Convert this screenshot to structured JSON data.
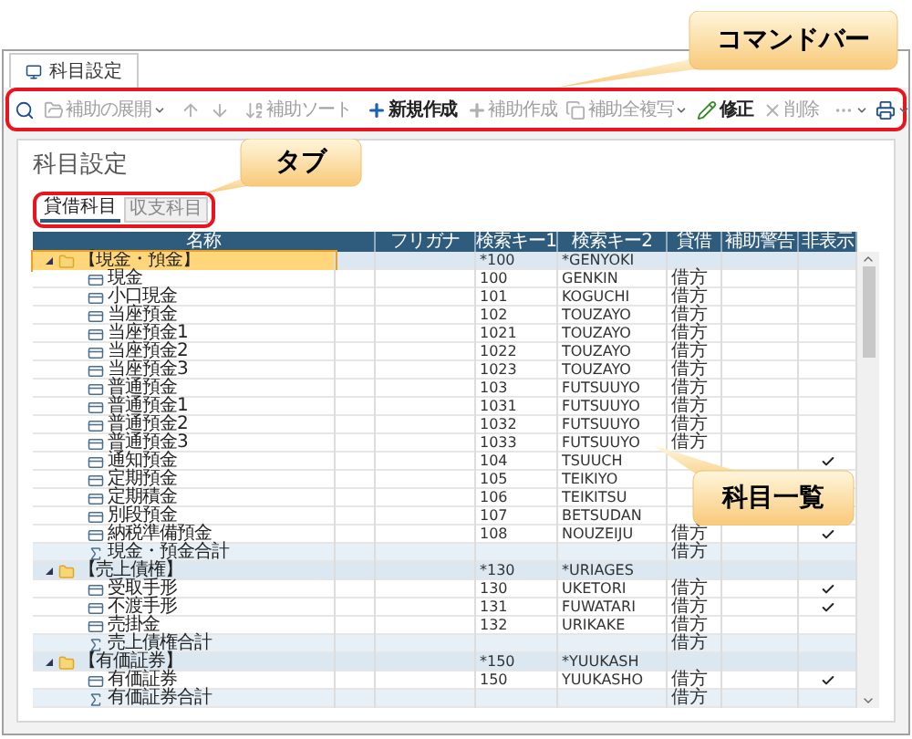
{
  "window": {
    "tab": "科目設定"
  },
  "toolbar": {
    "groups": [
      [
        {
          "disabled": false
        },
        {
          "label": "補助の展開",
          "dropdown": true,
          "disabled": true
        }
      ],
      [
        {
          "disabled": true
        },
        {
          "disabled": true
        }
      ],
      [
        {
          "label": "補助ソート",
          "disabled": true
        }
      ],
      [
        {
          "label": "新規作成",
          "disabled": false
        },
        {
          "label": "補助作成",
          "disabled": true
        },
        {
          "label": "補助全複写",
          "dropdown": true,
          "disabled": true
        },
        {
          "label": "修正",
          "disabled": false
        },
        {
          "label": "削除",
          "disabled": true
        }
      ],
      [
        {
          "dropdown": true,
          "disabled": true
        }
      ]
    ],
    "right": [
      {
        "dropdown": true,
        "disabled": false
      }
    ]
  },
  "page_title": "科目設定",
  "tabs": [
    {
      "label": "貸借科目",
      "selected": true
    },
    {
      "label": "収支科目",
      "selected": false
    }
  ],
  "table": {
    "columns": [
      "名称",
      "フリガナ",
      "検索キー1",
      "検索キー2",
      "貸借",
      "補助警告",
      "非表示"
    ],
    "rows": [
      {
        "kind": "group",
        "name": "【現金・預金】",
        "key1": "*100",
        "key2": "*GENYOKI",
        "expanded": true,
        "selected": true,
        "children": [
          {
            "kind": "account",
            "name": "現金",
            "key1": "100",
            "key2": "GENKIN",
            "drcr": "借方",
            "selected": false,
            "hidden": false
          },
          {
            "kind": "account",
            "name": "小口現金",
            "key1": "101",
            "key2": "KOGUCHI",
            "drcr": "借方",
            "selected": false,
            "hidden": false
          },
          {
            "kind": "account",
            "name": "当座預金",
            "key1": "102",
            "key2": "TOUZAYO",
            "drcr": "借方",
            "selected": false,
            "hidden": false
          },
          {
            "kind": "account",
            "name": "当座預金1",
            "key1": "1021",
            "key2": "TOUZAYO",
            "drcr": "借方",
            "selected": false,
            "hidden": false
          },
          {
            "kind": "account",
            "name": "当座預金2",
            "key1": "1022",
            "key2": "TOUZAYO",
            "drcr": "借方",
            "selected": false,
            "hidden": false
          },
          {
            "kind": "account",
            "name": "当座預金3",
            "key1": "1023",
            "key2": "TOUZAYO",
            "drcr": "借方",
            "selected": false,
            "hidden": false
          },
          {
            "kind": "account",
            "name": "普通預金",
            "key1": "103",
            "key2": "FUTSUUYO",
            "drcr": "借方",
            "selected": false,
            "hidden": false
          },
          {
            "kind": "account",
            "name": "普通預金1",
            "key1": "1031",
            "key2": "FUTSUUYO",
            "drcr": "借方",
            "selected": false,
            "hidden": false
          },
          {
            "kind": "account",
            "name": "普通預金2",
            "key1": "1032",
            "key2": "FUTSUUYO",
            "drcr": "借方",
            "selected": false,
            "hidden": false
          },
          {
            "kind": "account",
            "name": "普通預金3",
            "key1": "1033",
            "key2": "FUTSUUYO",
            "drcr": "借方",
            "selected": false,
            "hidden": false
          },
          {
            "kind": "account",
            "name": "通知預金",
            "key1": "104",
            "key2": "TSUUCH",
            "selected": false,
            "hidden": true
          },
          {
            "kind": "account",
            "name": "定期預金",
            "key1": "105",
            "key2": "TEIKIYO",
            "selected": false,
            "hidden": false
          },
          {
            "kind": "account",
            "name": "定期積金",
            "key1": "106",
            "key2": "TEIKITSU",
            "selected": false,
            "hidden": false
          },
          {
            "kind": "account",
            "name": "別段預金",
            "key1": "107",
            "key2": "BETSUDAN",
            "selected": false,
            "hidden": false
          },
          {
            "kind": "account",
            "name": "納税準備預金",
            "key1": "108",
            "key2": "NOUZEIJU",
            "drcr": "借方",
            "selected": false,
            "hidden": true
          },
          {
            "kind": "total",
            "name": "現金・預金合計",
            "drcr": "借方",
            "selected": false,
            "hidden": false
          }
        ]
      },
      {
        "kind": "group",
        "name": "【売上債権】",
        "key1": "*130",
        "key2": "*URIAGES",
        "expanded": true,
        "selected": false,
        "children": [
          {
            "kind": "account",
            "name": "受取手形",
            "key1": "130",
            "key2": "UKETORI",
            "drcr": "借方",
            "selected": false,
            "hidden": true
          },
          {
            "kind": "account",
            "name": "不渡手形",
            "key1": "131",
            "key2": "FUWATARI",
            "drcr": "借方",
            "selected": false,
            "hidden": true
          },
          {
            "kind": "account",
            "name": "売掛金",
            "key1": "132",
            "key2": "URIKAKE",
            "drcr": "借方",
            "selected": false,
            "hidden": false
          },
          {
            "kind": "total",
            "name": "売上債権合計",
            "drcr": "借方",
            "selected": false,
            "hidden": false
          }
        ]
      },
      {
        "kind": "group",
        "name": "【有価証券】",
        "key1": "*150",
        "key2": "*YUUKASH",
        "expanded": true,
        "selected": false,
        "children": [
          {
            "kind": "account",
            "name": "有価証券",
            "key1": "150",
            "key2": "YUUKASHO",
            "drcr": "借方",
            "selected": false,
            "hidden": true
          },
          {
            "kind": "total",
            "name": "有価証券合計",
            "drcr": "借方",
            "selected": false,
            "hidden": false
          }
        ]
      }
    ]
  },
  "callouts": [
    {
      "text": "コマンドバー"
    },
    {
      "text": "タブ"
    },
    {
      "text": "科目一覧"
    }
  ]
}
